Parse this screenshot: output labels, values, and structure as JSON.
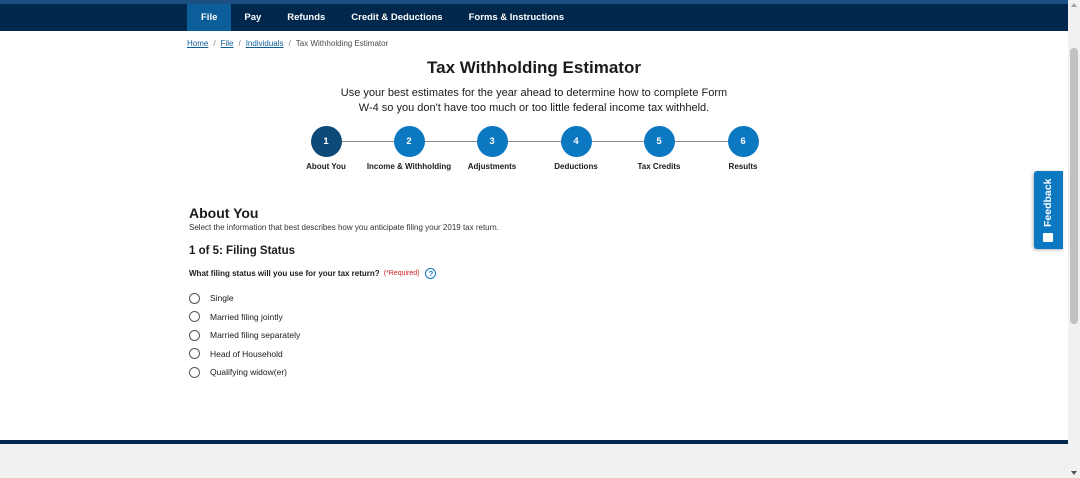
{
  "nav": {
    "items": [
      {
        "label": "File"
      },
      {
        "label": "Pay"
      },
      {
        "label": "Refunds"
      },
      {
        "label": "Credit & Deductions"
      },
      {
        "label": "Forms & Instructions"
      }
    ],
    "active_index": 0
  },
  "breadcrumb": {
    "items": [
      "Home",
      "File",
      "Individuals"
    ],
    "current": "Tax Withholding Estimator"
  },
  "page": {
    "title": "Tax Withholding Estimator",
    "intro": "Use your best estimates for the year ahead to determine how to complete Form W-4 so you don't have too much or too little federal income tax withheld."
  },
  "stepper": {
    "current": 1,
    "steps": [
      {
        "number": "1",
        "label": "About You"
      },
      {
        "number": "2",
        "label": "Income & Withholding"
      },
      {
        "number": "3",
        "label": "Adjustments"
      },
      {
        "number": "4",
        "label": "Deductions"
      },
      {
        "number": "5",
        "label": "Tax Credits"
      },
      {
        "number": "6",
        "label": "Results"
      }
    ]
  },
  "section": {
    "title": "About You",
    "description": "Select the information that best describes how you anticipate filing your 2019 tax return.",
    "subtitle": "1 of 5: Filing Status",
    "question": "What filing status will you use for your tax return?",
    "required": "(*Required)",
    "help": "?",
    "options": [
      "Single",
      "Married filing jointly",
      "Married filing separately",
      "Head of Household",
      "Qualifying widow(er)"
    ]
  },
  "feedback": {
    "label": "Feedback",
    "icon": "speech-bubble-icon"
  },
  "colors": {
    "nav_bg": "#00284d",
    "active_tab": "#0b5e9a",
    "step": "#0b78c1",
    "step_current": "#0e4a78",
    "required": "#cd2026"
  }
}
